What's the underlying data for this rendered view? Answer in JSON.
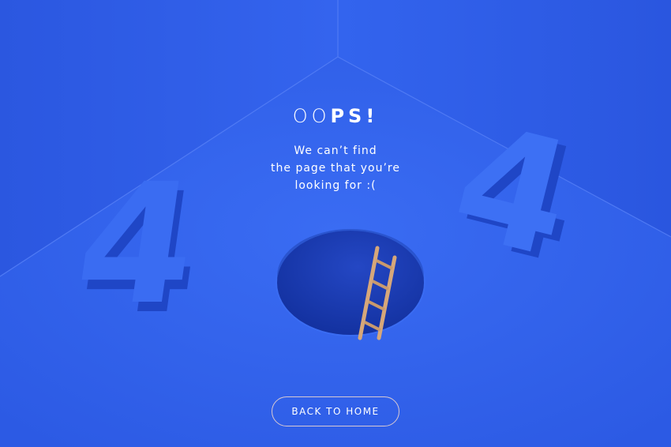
{
  "page": {
    "headline_light": "OO",
    "headline_bold": "PS!",
    "message_lines": [
      "We can’t find",
      "the page that you’re",
      "looking for :("
    ],
    "left_digit": "4",
    "right_digit": "4",
    "home_button_label": "BACK TO HOME"
  },
  "colors": {
    "background": "#2f5de6",
    "digit_face": "#3a6cf2",
    "digit_side": "#1f46c6",
    "hole": "#1a3fb8",
    "ladder": "#d6a77a",
    "button_border": "#d7c8d2",
    "text": "#ffffff"
  },
  "icons": {
    "ladder": "ladder-illustration",
    "hole": "hole-illustration"
  }
}
